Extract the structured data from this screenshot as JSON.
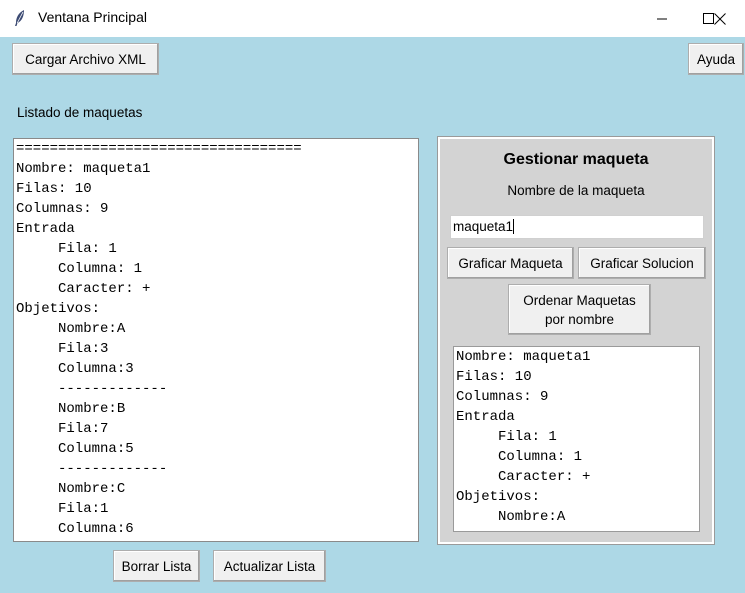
{
  "window": {
    "title": "Ventana Principal"
  },
  "toolbar": {
    "load_xml_label": "Cargar Archivo XML",
    "help_label": "Ayuda"
  },
  "list_section": {
    "heading": "Listado de maquetas",
    "lines": [
      "==================================",
      "Nombre: maqueta1",
      "Filas: 10",
      "Columnas: 9",
      "Entrada",
      "     Fila: 1",
      "     Columna: 1",
      "     Caracter: +",
      "Objetivos:",
      "     Nombre:A",
      "     Fila:3",
      "     Columna:3",
      "     -------------",
      "     Nombre:B",
      "     Fila:7",
      "     Columna:5",
      "     -------------",
      "     Nombre:C",
      "     Fila:1",
      "     Columna:6"
    ],
    "clear_label": "Borrar Lista",
    "refresh_label": "Actualizar Lista"
  },
  "manage_panel": {
    "title": "Gestionar maqueta",
    "name_label": "Nombre de la maqueta",
    "name_value": "maqueta1",
    "graph_model_label": "Graficar Maqueta",
    "graph_solution_label": "Graficar Solucion",
    "sort_label_line1": "Ordenar Maquetas",
    "sort_label_line2": "por nombre",
    "detail_lines": [
      "Nombre: maqueta1",
      "Filas: 10",
      "Columnas: 9",
      "Entrada",
      "     Fila: 1",
      "     Columna: 1",
      "     Caracter: +",
      "Objetivos:",
      "     Nombre:A"
    ]
  },
  "colors": {
    "background": "#add8e6",
    "panel": "#d3d3d3",
    "button": "#f0f0f0"
  },
  "icons": {
    "app": "feather-icon",
    "minimize": "minimize-icon",
    "maximize": "maximize-icon",
    "close": "close-icon"
  }
}
